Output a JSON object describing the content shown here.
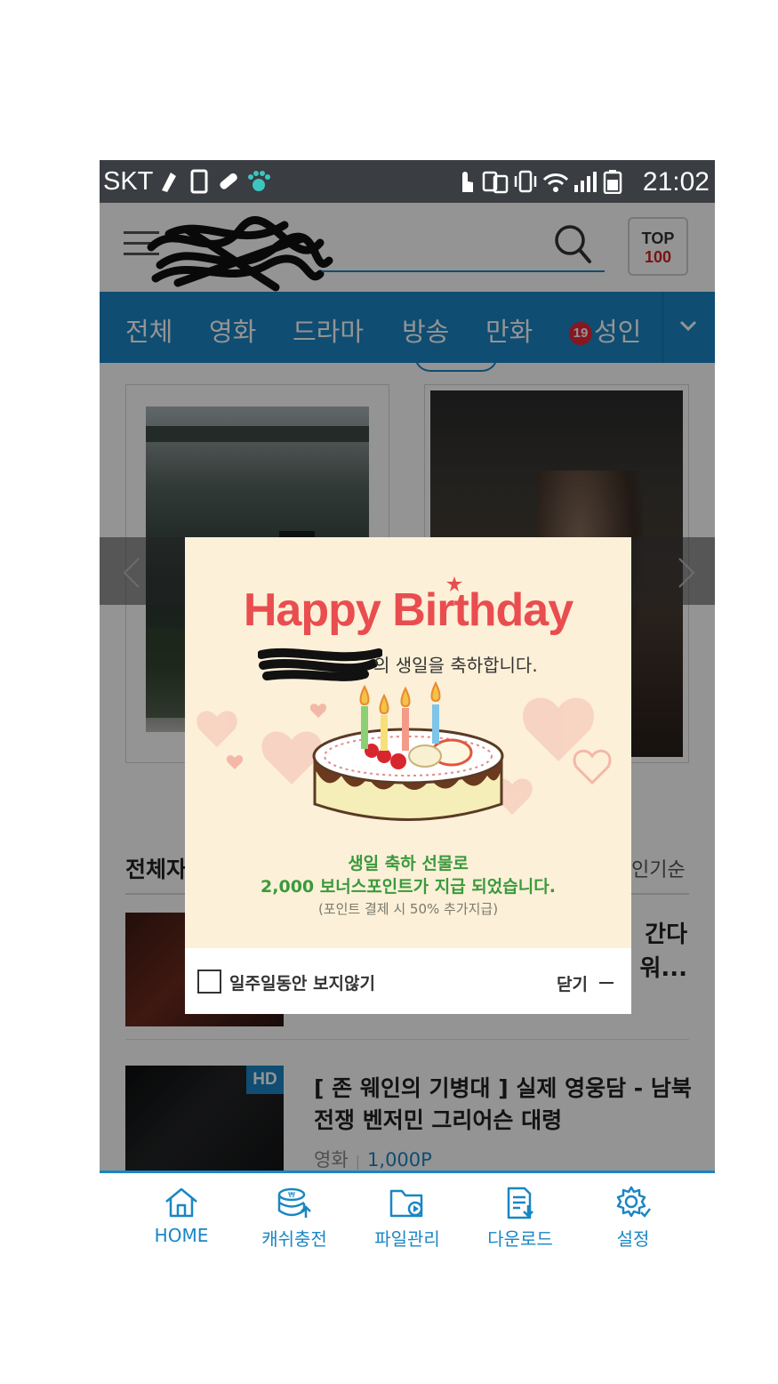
{
  "status_bar": {
    "carrier": "SKT",
    "time": "21:02"
  },
  "header": {
    "top_badge_line1": "TOP",
    "top_badge_line2": "100"
  },
  "categories": [
    {
      "label": "전체"
    },
    {
      "label": "영화"
    },
    {
      "label": "드라마"
    },
    {
      "label": "방송"
    },
    {
      "label": "만화"
    },
    {
      "label": "성인",
      "badge": "19"
    }
  ],
  "section": {
    "title": "전체자",
    "sort": "인기순"
  },
  "items": [
    {
      "title": "간다\n워..."
    },
    {
      "badge": "HD",
      "title": "[ 존 웨인의 기병대 ] 실제 영웅담 - 남북 전쟁 벤저민 그리어슨 대령",
      "genre": "영화",
      "price": "1,000P"
    }
  ],
  "popup": {
    "heading": "Happy Birthday",
    "greeting": "의 생일을 축하합니다.",
    "gift_line1": "생일 축하 선물로",
    "gift_line2": "2,000 보너스포인트가 지급 되었습니다.",
    "gift_note": "(포인트 결제 시 50% 추가지급)",
    "hide_week_label": "일주일동안 보지않기",
    "close_label": "닫기"
  },
  "bottom_nav": [
    {
      "label": "HOME",
      "icon": "home-icon"
    },
    {
      "label": "캐쉬충전",
      "icon": "cash-charge-icon"
    },
    {
      "label": "파일관리",
      "icon": "file-manage-icon"
    },
    {
      "label": "다운로드",
      "icon": "download-icon"
    },
    {
      "label": "설정",
      "icon": "settings-icon"
    }
  ],
  "colors": {
    "brand_blue": "#1a86c4",
    "birthday_red": "#e94d4f",
    "gift_green": "#3a9a3c",
    "popup_bg": "#fcf0d8"
  }
}
